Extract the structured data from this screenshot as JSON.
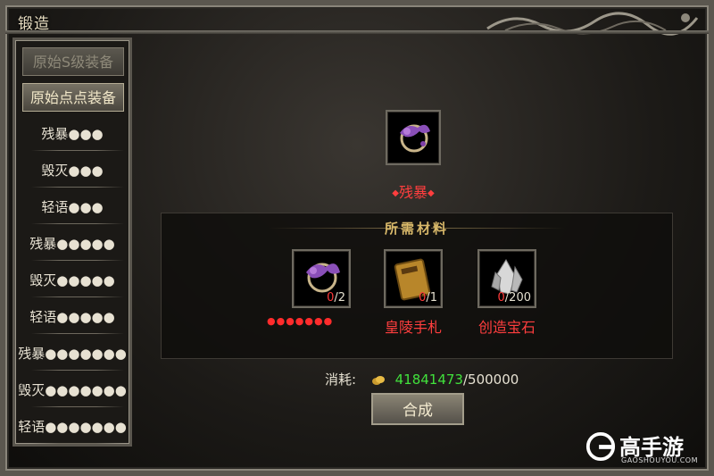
{
  "window": {
    "title": "锻造"
  },
  "sidebar": {
    "tabs": [
      {
        "label": "原始S级装备"
      },
      {
        "label": "原始点点装备"
      }
    ],
    "items": [
      {
        "label": "残暴●●●"
      },
      {
        "label": "毁灭●●●"
      },
      {
        "label": "轻语●●●"
      },
      {
        "label": "残暴●●●●●"
      },
      {
        "label": "毁灭●●●●●"
      },
      {
        "label": "轻语●●●●●"
      },
      {
        "label": "残暴●●●●●●●"
      },
      {
        "label": "毁灭●●●●●●●"
      },
      {
        "label": "轻语●●●●●●●"
      }
    ]
  },
  "target": {
    "name": "残暴",
    "icon": "purple-dragon-ring-icon"
  },
  "materials": {
    "title": "所需材料",
    "items": [
      {
        "have": "0",
        "need": "/2",
        "icon": "purple-dragon-ring-icon",
        "stars": "●●●●●●●"
      },
      {
        "have": "0",
        "need": "/1",
        "icon": "gold-book-icon",
        "name": "皇陵手札"
      },
      {
        "have": "0",
        "need": "/200",
        "icon": "crystal-gem-icon",
        "name": "创造宝石"
      }
    ]
  },
  "cost": {
    "label": "消耗:",
    "have": "41841473",
    "need": "/500000",
    "icon": "gold-coin-icon"
  },
  "action": {
    "label": "合成"
  },
  "watermark": {
    "text": "高手游",
    "sub": "GAOSHOUYOU.COM"
  },
  "colors": {
    "accent_red": "#ff3e3e",
    "accent_green": "#41e13c",
    "gold": "#d9b96a"
  }
}
